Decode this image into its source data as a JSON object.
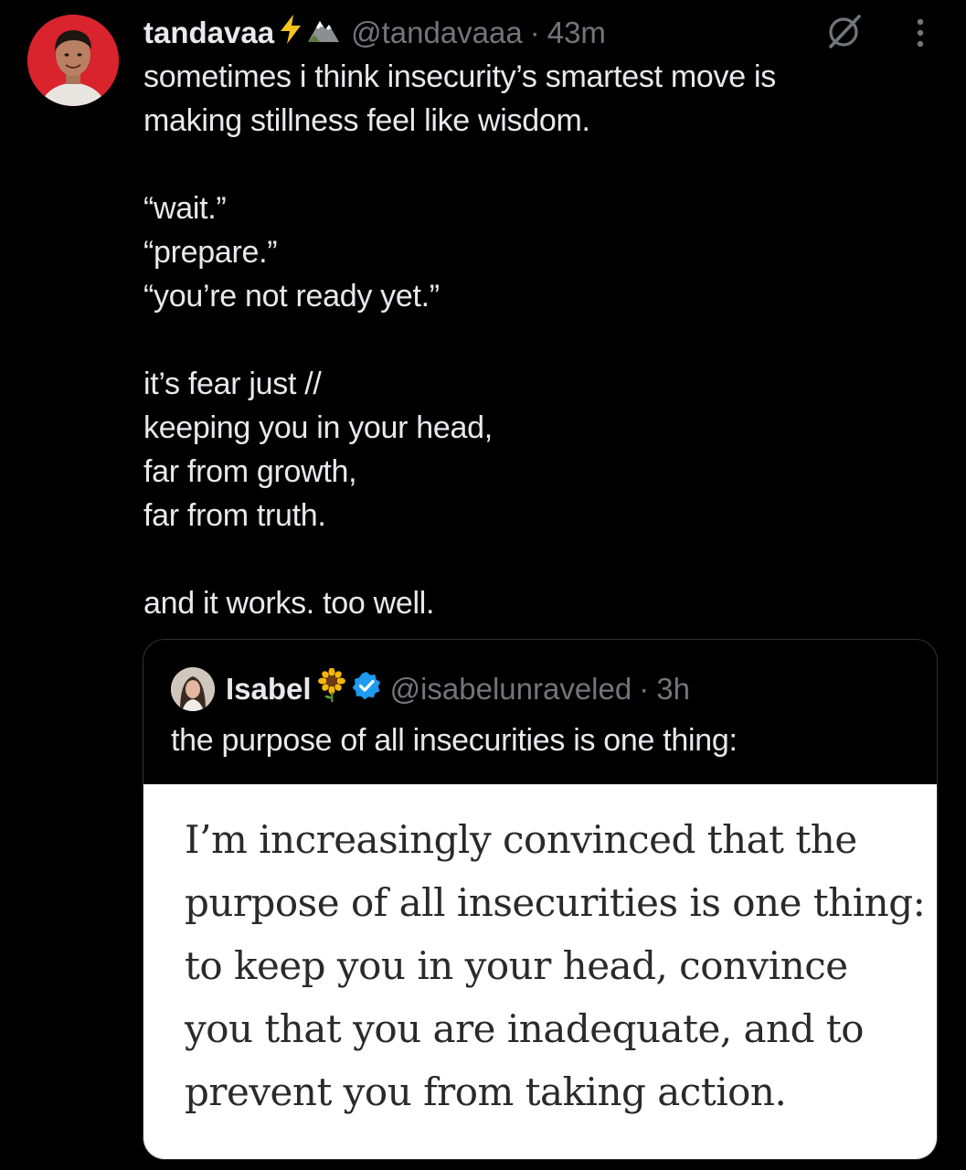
{
  "post": {
    "author": {
      "display_name": "tandavaa",
      "name_emojis": [
        "lightning-emoji",
        "mountain-emoji"
      ],
      "handle": "@tandavaaa",
      "separator": "·",
      "time": "43m"
    },
    "body_lines": [
      "sometimes i think insecurity’s smartest move is",
      "making stillness feel like wisdom.",
      "",
      "“wait.”",
      "“prepare.”",
      "“you’re not ready yet.”",
      "",
      "it’s fear just //",
      "keeping you in your head,",
      "far from growth,",
      "far from truth.",
      "",
      "and it works. too well."
    ],
    "icons": {
      "grok": "grok-icon",
      "more": "more-vertical-icon"
    },
    "colors": {
      "background": "#000000",
      "text": "#e7e9ea",
      "muted": "#71767b",
      "verified": "#1d9bf0",
      "avatar_bg": "#d9232d"
    }
  },
  "quote": {
    "author": {
      "display_name": "Isabel",
      "name_emoji": "sunflower-emoji",
      "verified": true,
      "handle": "@isabelunraveled",
      "separator": "·",
      "time": "3h"
    },
    "text": "the purpose of all insecurities is one thing:",
    "image_text_lines": [
      "I’m increasingly convinced that the",
      "purpose of all insecurities is one thing:",
      "to keep you in your head, convince",
      "you that you are inadequate, and to",
      "prevent you from taking action."
    ]
  }
}
